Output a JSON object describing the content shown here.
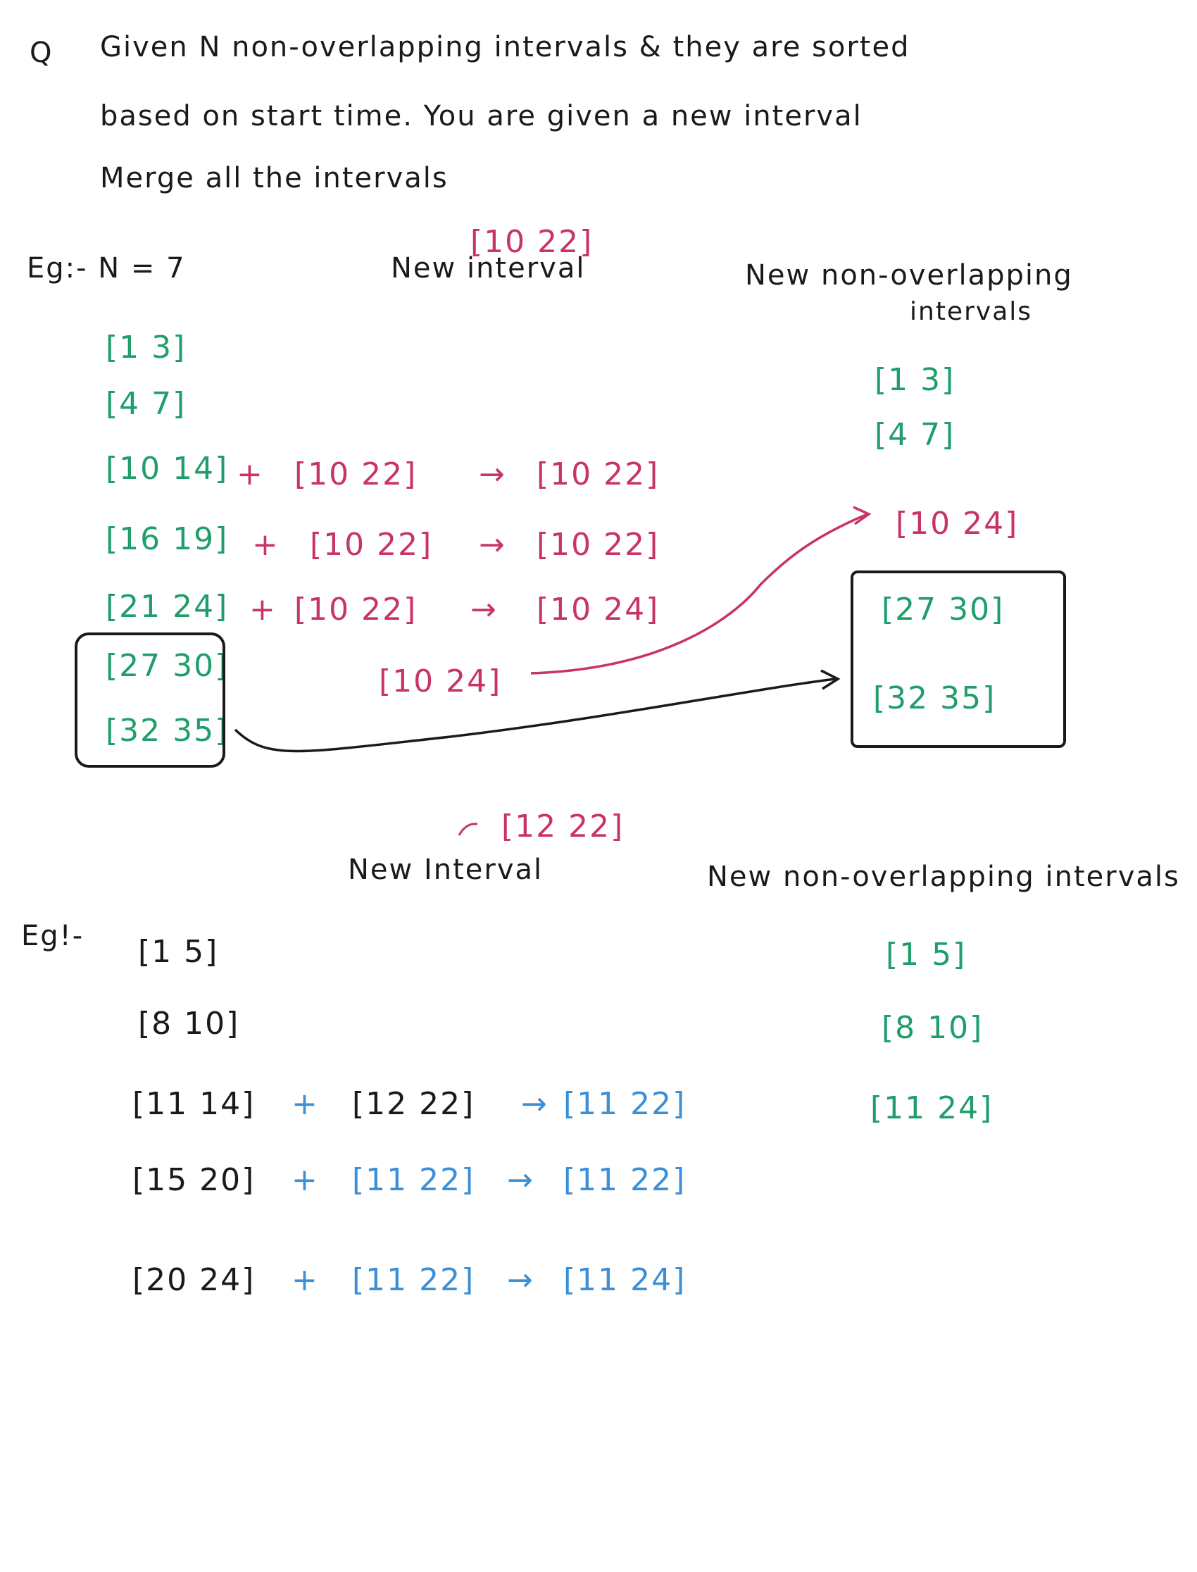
{
  "colors": {
    "ink": "#1a1a1a",
    "green": "#1f9e6b",
    "pink": "#c8336a",
    "blue": "#3b8fd6"
  },
  "question": {
    "marker": "Q",
    "line1": "Given  N  non-overlapping  intervals  &  they  are  sorted",
    "line2": "based  on  start time. You  are  given  a  new  interval",
    "line3": "Merge  all  the  intervals"
  },
  "example1": {
    "label": "Eg:-  N = 7",
    "new_interval_value": "[10  22]",
    "new_interval_heading": "New  interval",
    "result_heading_1": "New   non-overlapping",
    "result_heading_2": "intervals",
    "intervals": [
      "[1   3]",
      "[4   7]",
      "[10  14]",
      "[16  19]",
      "[21  24]",
      "[27  30]",
      "[32  35]"
    ],
    "steps": [
      {
        "plus": "+",
        "merge": "[10   22]",
        "arrow": "→",
        "result": "[10   22]"
      },
      {
        "plus": "+",
        "merge": "[10   22]",
        "arrow": "→",
        "result": "[10   22]"
      },
      {
        "plus": "+",
        "merge": "[10   22]",
        "arrow": "→",
        "result": "[10   24]"
      }
    ],
    "final_merged": "[10  24]",
    "result": [
      "[1   3]",
      "[4   7]",
      "[10  24]",
      "[27   30]",
      "[32   35]"
    ]
  },
  "example2": {
    "label": "Eg!-",
    "new_interval_value": "[12   22]",
    "new_interval_heading": "New  Interval",
    "result_heading": "New   non-overlapping  intervals",
    "intervals": [
      "[1   5]",
      "[8   10]",
      "[11   14]",
      "[15  20]",
      "[20   24]"
    ],
    "steps": [
      {
        "plus": "+",
        "merge": "[12   22]",
        "arrow": "→",
        "result": "[11   22]"
      },
      {
        "plus": "+",
        "merge": "[11   22]",
        "arrow": "→",
        "result": "[11   22]"
      },
      {
        "plus": "+",
        "merge": "[11   22]",
        "arrow": "→",
        "result": "[11   24]"
      }
    ],
    "result": [
      "[1   5]",
      "[8   10]",
      "[11   24]"
    ]
  }
}
